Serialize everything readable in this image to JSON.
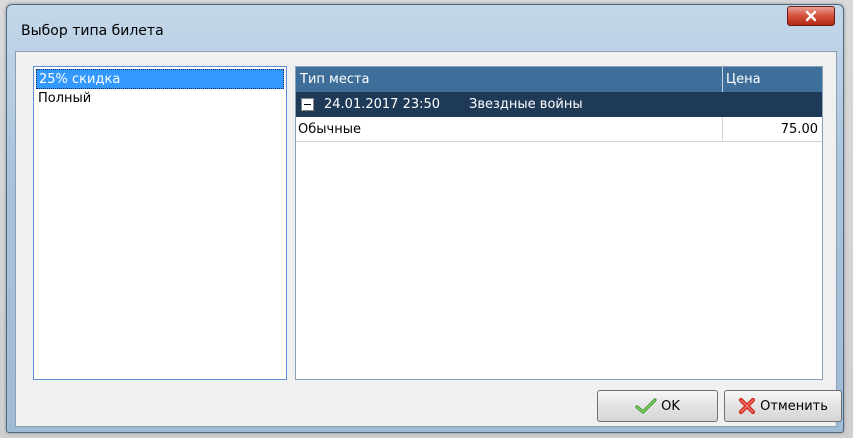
{
  "window": {
    "title": "Выбор типа билета"
  },
  "ticket_types": [
    {
      "label": "25% скидка",
      "selected": true
    },
    {
      "label": "Полный",
      "selected": false
    }
  ],
  "grid": {
    "columns": [
      "Тип места",
      "Цена"
    ],
    "group": {
      "datetime": "24.01.2017 23:50",
      "title": "Звездные войны",
      "expanded": true
    },
    "rows": [
      {
        "type": "Обычные",
        "price": "75.00"
      }
    ]
  },
  "buttons": {
    "ok_label": "OK",
    "cancel_label": "Отменить"
  },
  "icons": {
    "close": "close-icon",
    "ok": "checkmark-icon",
    "cancel": "red-cross-icon",
    "expander": "collapse-minus-icon"
  },
  "colors": {
    "selection": "#3399ff",
    "header": "#3e6e9a",
    "group_row": "#1f3a57",
    "close_button": "#d24f3a"
  }
}
